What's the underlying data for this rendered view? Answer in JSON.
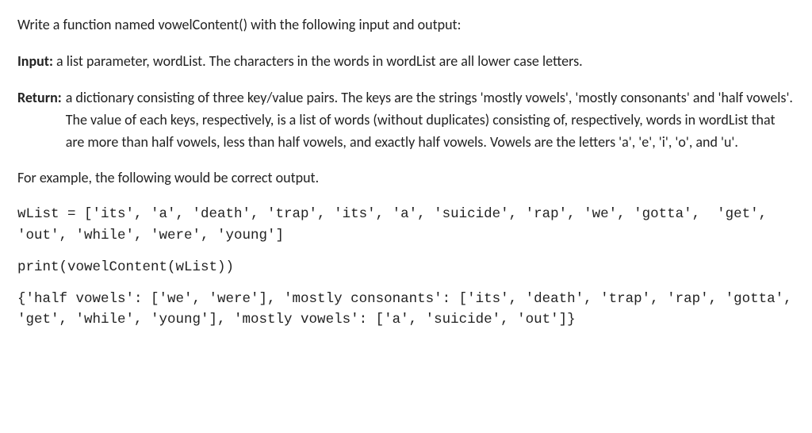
{
  "p1": "Write a function named vowelContent() with the following input and output:",
  "input_label": "Input:",
  "input_body": " a list parameter, wordList. The characters in the words in wordList are all lower case letters.",
  "return_label": "Return:",
  "return_body": " a dictionary consisting of three key/value pairs. The keys are the strings 'mostly vowels', 'mostly consonants' and 'half vowels'. The value of each keys, respectively, is a list of words (without duplicates) consisting of, respectively, words in wordList that are more than half vowels, less than half vowels, and exactly half vowels. Vowels are the letters 'a', 'e', 'i', 'o', and 'u'.",
  "p_example": "For example, the following would be correct output.",
  "code1": "wList = ['its', 'a', 'death', 'trap', 'its', 'a', 'suicide', 'rap', 'we', 'gotta',  'get', 'out', 'while', 'were', 'young']",
  "code2": "print(vowelContent(wList))",
  "code3": "{'half vowels': ['we', 'were'], 'mostly consonants': ['its', 'death', 'trap', 'rap', 'gotta', 'get', 'while', 'young'], 'mostly vowels': ['a', 'suicide', 'out']}"
}
